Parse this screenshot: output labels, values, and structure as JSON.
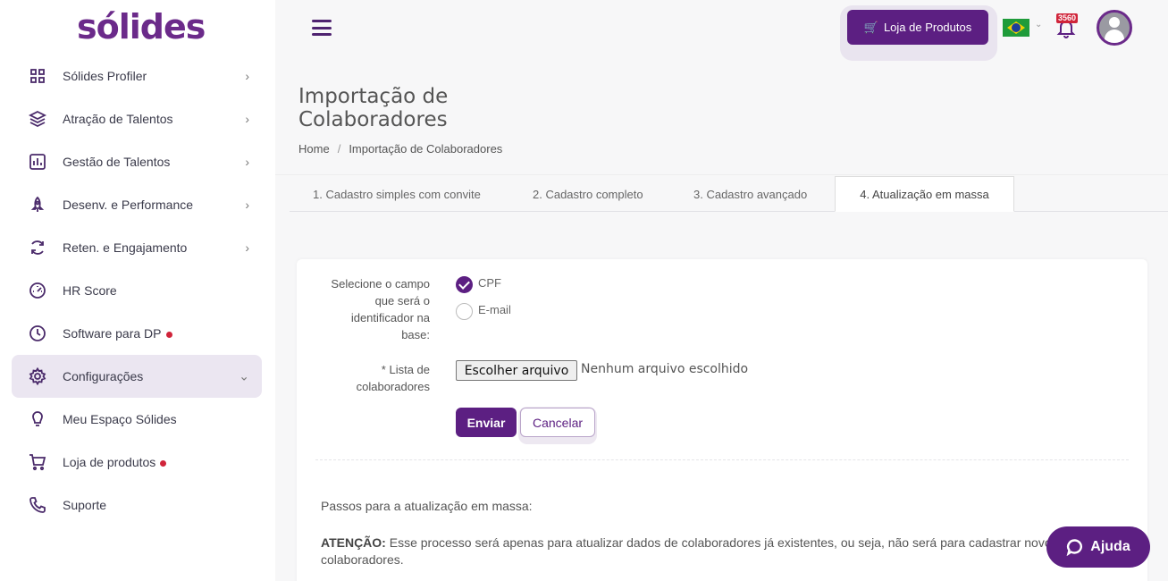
{
  "brand": {
    "logo": "sólides"
  },
  "sidebar": {
    "items": [
      {
        "label": "Sólides Profiler",
        "icon": "grid-icon",
        "chevron": "›"
      },
      {
        "label": "Atração de Talentos",
        "icon": "layers-icon",
        "chevron": "›"
      },
      {
        "label": "Gestão de Talentos",
        "icon": "bar-chart-icon",
        "chevron": "›"
      },
      {
        "label": "Desenv. e Performance",
        "icon": "rocket-icon",
        "chevron": "›"
      },
      {
        "label": "Reten. e Engajamento",
        "icon": "refresh-icon",
        "chevron": "›"
      },
      {
        "label": "HR Score",
        "icon": "gauge-icon"
      },
      {
        "label": "Software para DP",
        "icon": "clock-icon",
        "dot": true
      },
      {
        "label": "Configurações",
        "icon": "gear-icon",
        "chevron": "⌄",
        "active": true
      },
      {
        "label": "Meu Espaço Sólides",
        "icon": "lightbulb-icon"
      },
      {
        "label": "Loja de produtos",
        "icon": "cart-icon",
        "dot": true
      },
      {
        "label": "Suporte",
        "icon": "phone-icon"
      }
    ]
  },
  "topbar": {
    "store_label": "Loja de Produtos",
    "notifications_count": "3560",
    "language": "pt-BR"
  },
  "page": {
    "title": "Importação de Colaboradores",
    "breadcrumb": {
      "home": "Home",
      "separator": "/",
      "current": "Importação de Colaboradores"
    }
  },
  "tabs": [
    {
      "label": "1. Cadastro simples com convite"
    },
    {
      "label": "2. Cadastro completo"
    },
    {
      "label": "3. Cadastro avançado"
    },
    {
      "label": "4. Atualização em massa",
      "active": true
    }
  ],
  "form": {
    "identifier_label": "Selecione o campo que será o identificador na base:",
    "identifier_options": [
      {
        "label": "CPF",
        "checked": true
      },
      {
        "label": "E-mail",
        "checked": false
      }
    ],
    "file_label": "* Lista de colaboradores",
    "file_button": "Escolher arquivo",
    "file_status": "Nenhum arquivo escolhido",
    "submit_label": "Enviar",
    "cancel_label": "Cancelar"
  },
  "info": {
    "steps_title": "Passos para a atualização em massa:",
    "attention_label": "ATENÇÃO:",
    "attention_text": "Esse processo será apenas para atualizar dados de colaboradores já existentes, ou seja, não será para cadastrar novos",
    "attention_text_2": "colaboradores."
  },
  "help": {
    "label": "Ajuda"
  },
  "colors": {
    "brand": "#5c1f82",
    "active_bg": "#ebe6f1",
    "alert": "#d0243a"
  }
}
